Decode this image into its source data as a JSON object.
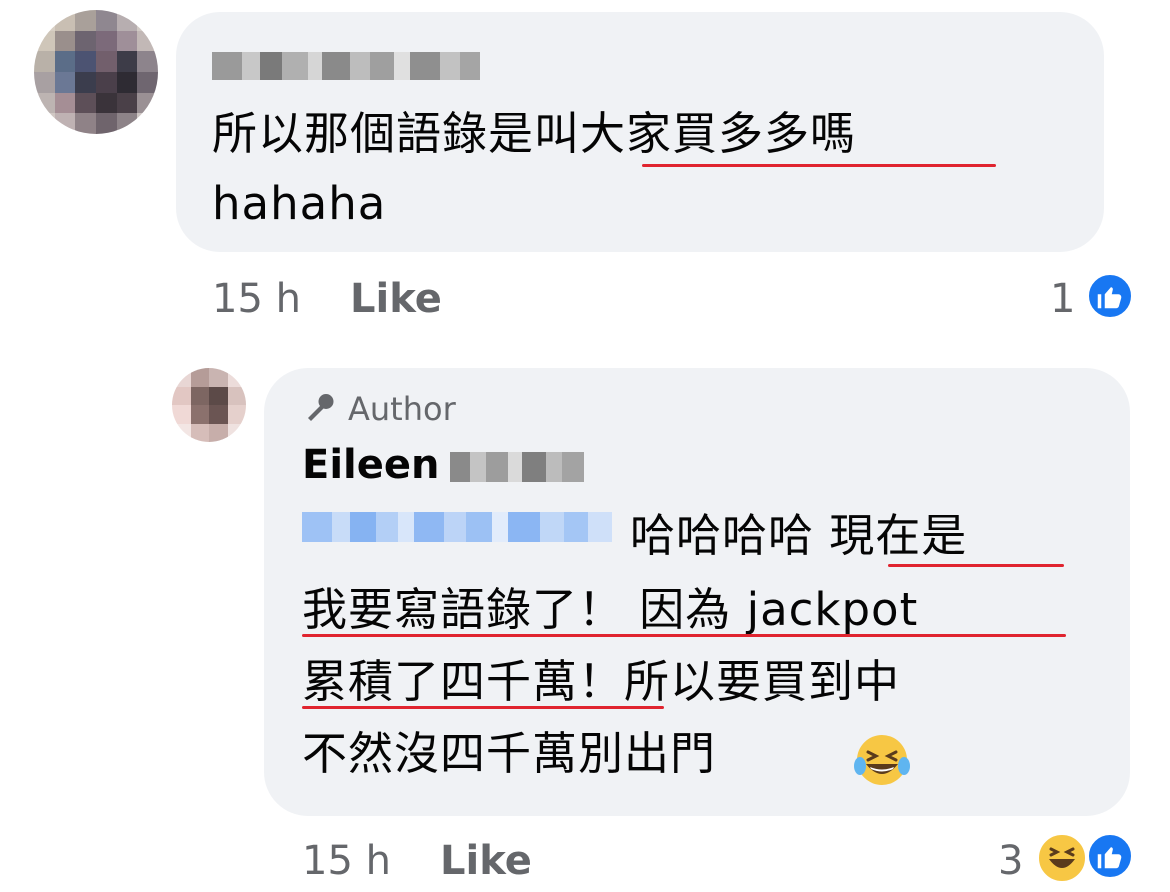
{
  "comments": [
    {
      "text_line1": "所以那個語錄是叫大家買多多嗎",
      "text_line2": "hahaha",
      "time": "15 h",
      "like_label": "Like",
      "reaction_count": "1",
      "reactions": [
        "like-icon"
      ]
    },
    {
      "author_badge": "Author",
      "name": "Eileen",
      "text_line1": "哈哈哈哈 現在是",
      "text_line2": "我要寫語錄了！ 因為 jackpot",
      "text_line3": "累積了四千萬！所以要買到中",
      "text_line4": "不然沒四千萬別出門",
      "time": "15 h",
      "like_label": "Like",
      "reaction_count": "3",
      "reactions": [
        "haha-icon",
        "like-icon"
      ]
    }
  ],
  "colors": {
    "bubble": "#f0f2f5",
    "meta_text": "#65676b",
    "like_blue": "#1877f2",
    "underline_red": "#e0242f",
    "haha_yellow": "#f7c744"
  }
}
